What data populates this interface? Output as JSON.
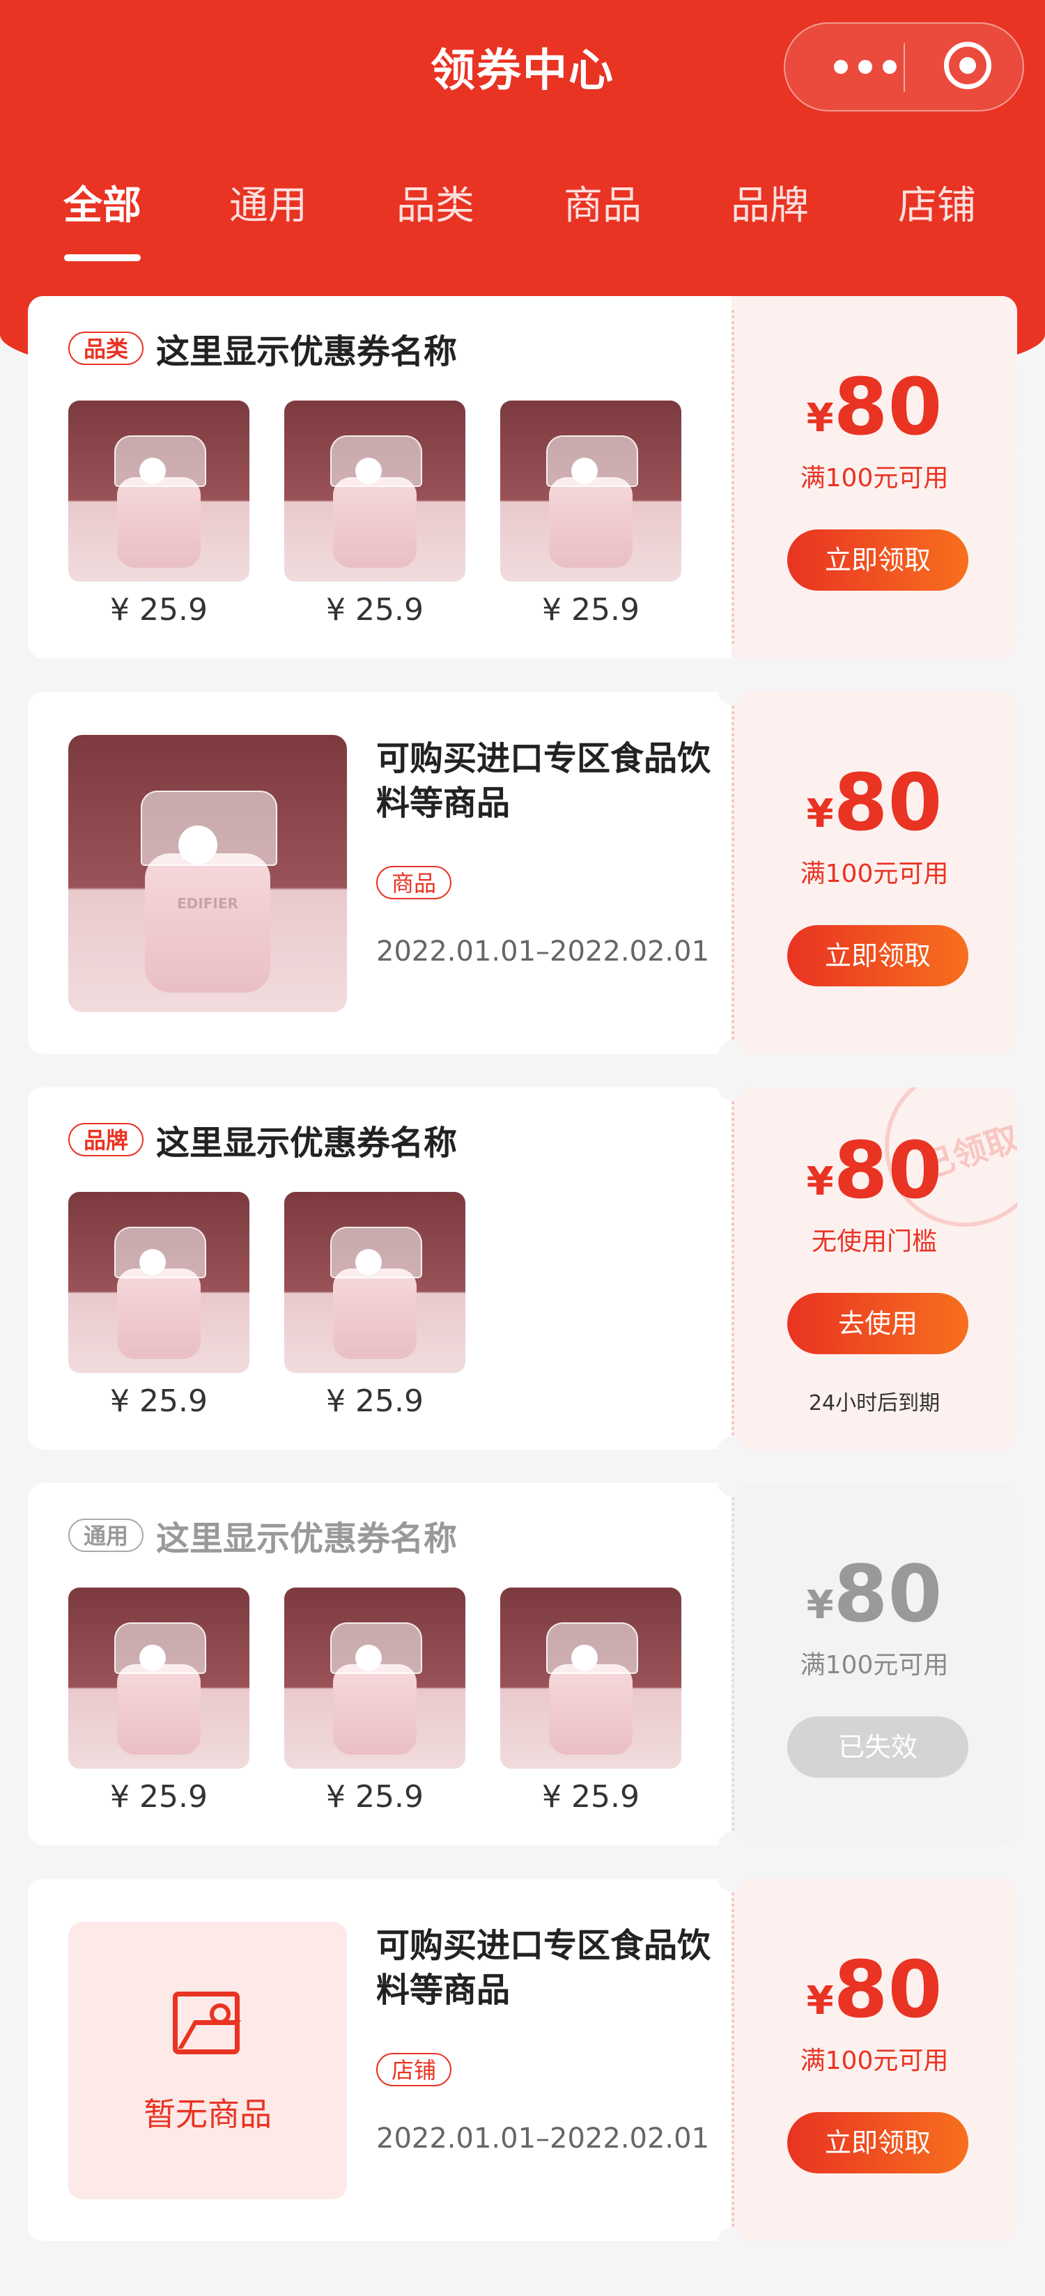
{
  "header": {
    "title": "领券中心"
  },
  "tabs": [
    {
      "label": "全部"
    },
    {
      "label": "通用"
    },
    {
      "label": "品类"
    },
    {
      "label": "商品"
    },
    {
      "label": "品牌"
    },
    {
      "label": "店铺"
    }
  ],
  "colors": {
    "accent": "#e93323",
    "accent_end": "#f7701e",
    "disabled": "#d4d4d4"
  },
  "coupons": [
    {
      "tag": "品类",
      "name": "这里显示优惠券名称",
      "products": [
        {
          "price": "¥ 25.9"
        },
        {
          "price": "¥ 25.9"
        },
        {
          "price": "¥ 25.9"
        }
      ],
      "currency": "¥",
      "amount": "80",
      "condition": "满100元可用",
      "button": "立即领取"
    },
    {
      "title": "可购买进口专区食品饮料等商品",
      "tag": "商品",
      "date": "2022.01.01–2022.02.01",
      "image_brand": "EDIFIER",
      "currency": "¥",
      "amount": "80",
      "condition": "满100元可用",
      "button": "立即领取"
    },
    {
      "tag": "品牌",
      "name": "这里显示优惠券名称",
      "products": [
        {
          "price": "¥ 25.9"
        },
        {
          "price": "¥ 25.9"
        }
      ],
      "currency": "¥",
      "amount": "80",
      "condition": "无使用门槛",
      "button": "去使用",
      "expire": "24小时后到期",
      "stamp": "已领取"
    },
    {
      "tag": "通用",
      "name": "这里显示优惠券名称",
      "products": [
        {
          "price": "¥ 25.9"
        },
        {
          "price": "¥ 25.9"
        },
        {
          "price": "¥ 25.9"
        }
      ],
      "currency": "¥",
      "amount": "80",
      "condition": "满100元可用",
      "button": "已失效"
    },
    {
      "title": "可购买进口专区食品饮料等商品",
      "tag": "店铺",
      "date": "2022.01.01–2022.02.01",
      "empty_text": "暂无商品",
      "currency": "¥",
      "amount": "80",
      "condition": "满100元可用",
      "button": "立即领取"
    }
  ]
}
